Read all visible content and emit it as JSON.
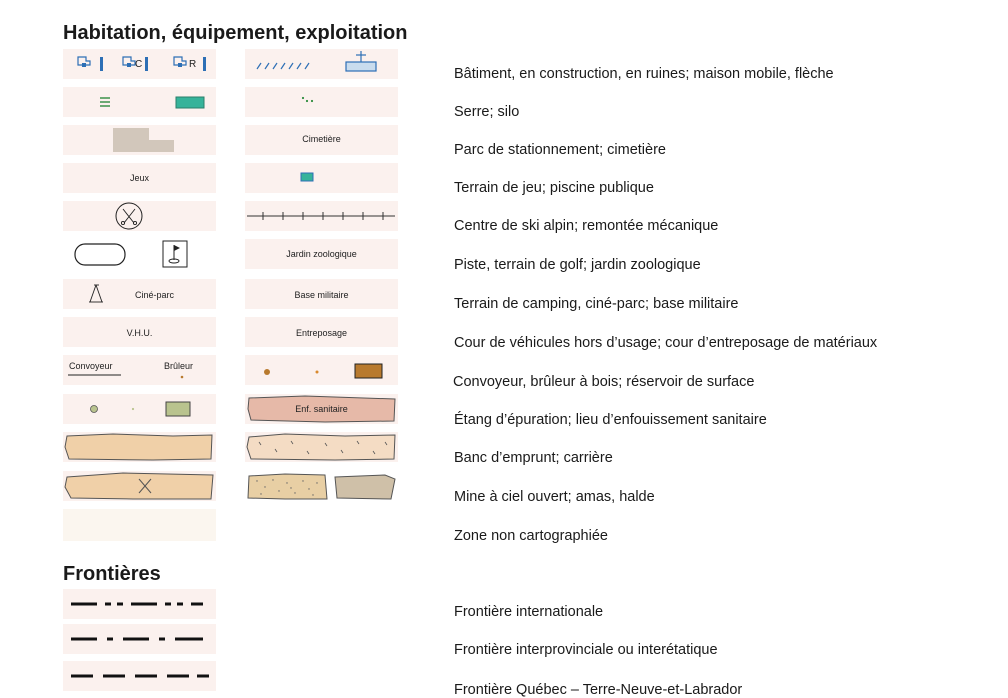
{
  "headings": {
    "habitation": "Habitation, équipement, exploitation",
    "frontieres": "Frontières"
  },
  "labels": {
    "cimetiere": "Cimetière",
    "jeux": "Jeux",
    "jardin": "Jardin zoologique",
    "cine_parc": "Ciné-parc",
    "base_militaire": "Base militaire",
    "vhu": "V.H.U.",
    "entreposage": "Entreposage",
    "convoyeur": "Convoyeur",
    "bruleur": "Brûleur",
    "bldg_c": "C",
    "bldg_r": "R",
    "enf_sanitaire": "Enf. sanitaire"
  },
  "descriptions": [
    "Bâtiment, en construction, en ruines; maison mobile, flèche",
    "Serre; silo",
    "Parc de stationnement; cimetière",
    "Terrain de jeu; piscine publique",
    "Centre de ski alpin; remontée mécanique",
    "Piste, terrain de golf; jardin zoologique",
    "Terrain de camping, ciné-parc;  base militaire",
    "Cour de véhicules hors d’usage; cour d’entreposage de matériaux",
    "Convoyeur, brûleur à bois;  réservoir de surface",
    "Étang d’épuration; lieu d’enfouissement sanitaire",
    "Banc d’emprunt; carrière",
    "Mine à ciel ouvert; amas, halde",
    "Zone non cartographiée"
  ],
  "frontier_descriptions": [
    "Frontière internationale",
    "Frontière interprovinciale ou interétatique",
    "Frontière Québec – Terre-Neuve-et-Labrador"
  ],
  "colors": {
    "swatch_bg": "#fbf1ee",
    "blue": "#2d6fb5",
    "teal": "#36b39a",
    "green_dark": "#2e8c3e",
    "parking": "#d2c7bb",
    "sand": "#f0d0a8",
    "pink": "#e6b9a8",
    "brown": "#b87a2e",
    "olive": "#b9c38e",
    "unmapped": "#fbf6ef"
  }
}
